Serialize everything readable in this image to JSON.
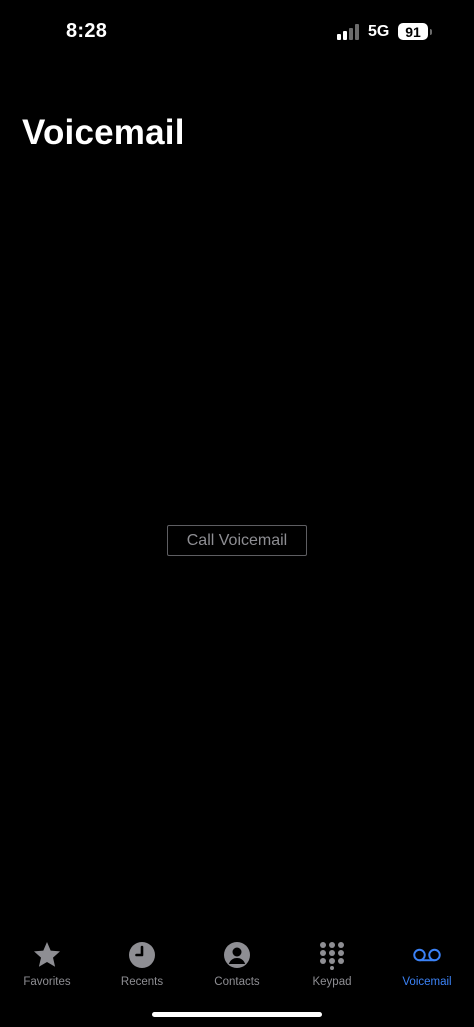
{
  "status_bar": {
    "time": "8:28",
    "network": "5G",
    "battery": "91",
    "signal_icon": "cellular-signal-icon"
  },
  "page": {
    "title": "Voicemail"
  },
  "actions": {
    "call_voicemail": "Call Voicemail"
  },
  "tab_bar": {
    "tabs": [
      {
        "label": "Favorites",
        "icon": "star-icon"
      },
      {
        "label": "Recents",
        "icon": "clock-icon"
      },
      {
        "label": "Contacts",
        "icon": "person-icon"
      },
      {
        "label": "Keypad",
        "icon": "keypad-icon"
      },
      {
        "label": "Voicemail",
        "icon": "voicemail-icon",
        "active": true
      }
    ]
  },
  "colors": {
    "background": "#000000",
    "accent": "#3b82f6",
    "inactive": "#8e8e93"
  }
}
